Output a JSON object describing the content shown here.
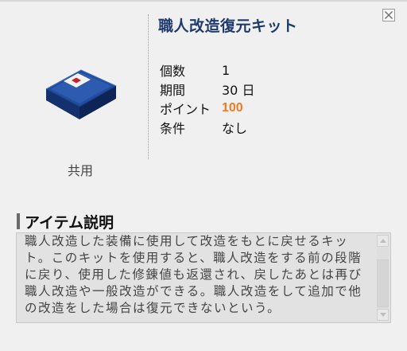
{
  "item": {
    "name": "職人改造復元キット",
    "category": "共用",
    "icon": "blue-box-kit-icon"
  },
  "properties": [
    {
      "label": "個数",
      "value": "1"
    },
    {
      "label": "期間",
      "value": "30 日"
    },
    {
      "label": "ポイント",
      "value": "100"
    },
    {
      "label": "条件",
      "value": "なし"
    }
  ],
  "description": {
    "header": "アイテム説明",
    "text": "職人改造した装備に使用して改造をもとに戻せるキット。このキットを使用すると、職人改造をする前の段階に戻り、使用した修錬値も返還され、戻したあとは再び職人改造や一般改造ができる。職人改造をして追加で他の改造をした場合は復元できないという。"
  },
  "colors": {
    "title": "#1f3a6d",
    "points": "#f07a21",
    "box_blue": "#1e3f86",
    "box_red": "#c8202a"
  }
}
